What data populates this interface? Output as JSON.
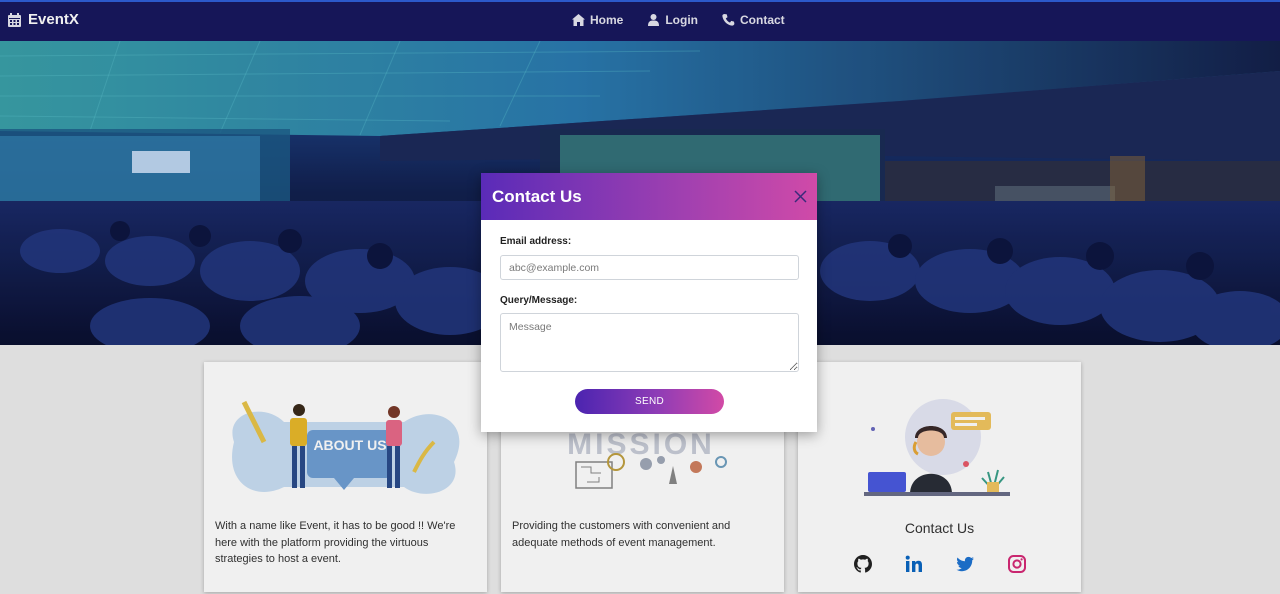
{
  "navbar": {
    "brand": "EventX",
    "brand_icon": "calendar-icon",
    "links": [
      {
        "label": "Home",
        "icon": "home-icon"
      },
      {
        "label": "Login",
        "icon": "user-icon"
      },
      {
        "label": "Contact",
        "icon": "phone-icon"
      }
    ]
  },
  "hero": {
    "image": "conference-hall-photo"
  },
  "cards": [
    {
      "image": "about-us-illustration",
      "image_text": "ABOUT US",
      "text": "With a name like Event, it has to be good !! We're here with the platform providing the virtuous strategies to host a event."
    },
    {
      "image": "mission-illustration",
      "image_text": "MISSION",
      "text": "Providing the customers with convenient and adequate methods of event management."
    },
    {
      "image": "support-agent-illustration",
      "title": "Contact Us",
      "social": [
        "github-icon",
        "linkedin-icon",
        "twitter-icon",
        "instagram-icon"
      ]
    }
  ],
  "modal": {
    "title": "Contact Us",
    "close_icon": "close-icon",
    "email_label": "Email address:",
    "email_placeholder": "abc@example.com",
    "email_value": "",
    "message_label": "Query/Message:",
    "message_placeholder": "Message",
    "message_value": "",
    "send_label": "SEND"
  },
  "colors": {
    "navbar": "#18185e",
    "modal_gradient_start": "#5a2bb8",
    "modal_gradient_end": "#d04aa8",
    "linkedin": "#0a66c2",
    "twitter": "#1da1f2",
    "instagram": "#d62976"
  }
}
